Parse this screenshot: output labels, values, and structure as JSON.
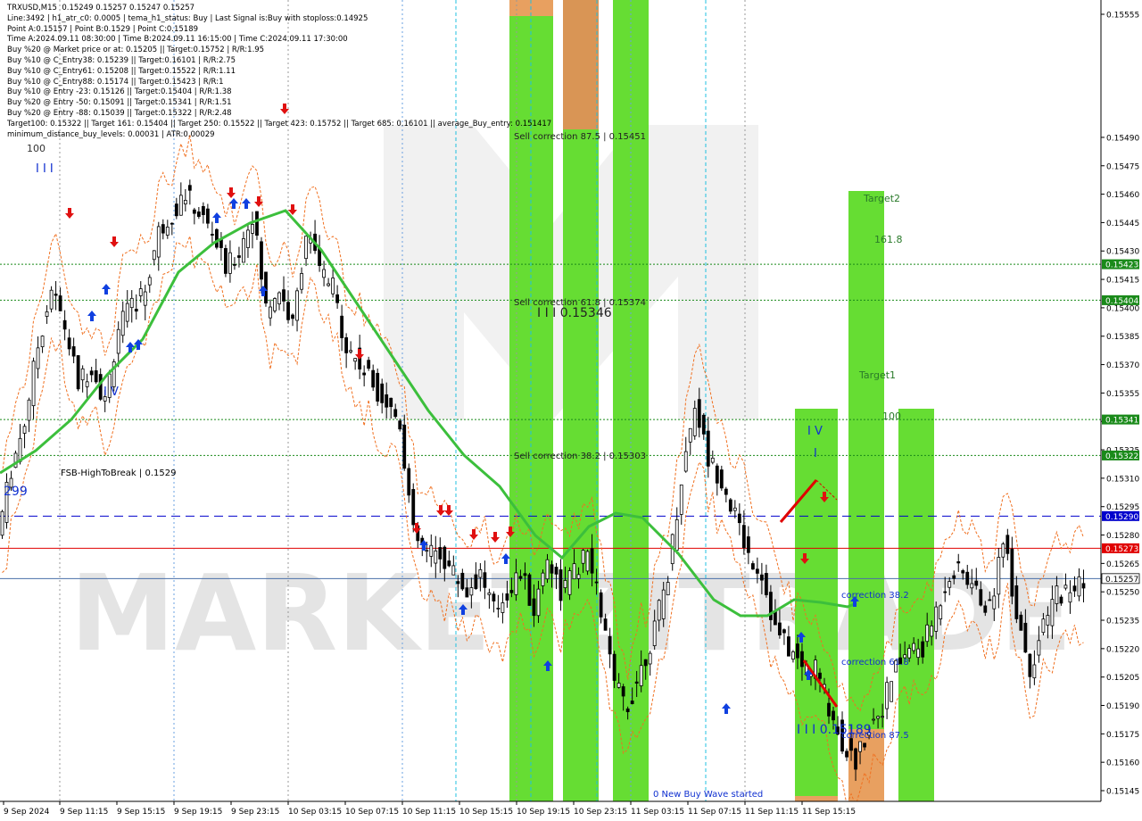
{
  "header": {
    "lines": [
      "TRXUSD,M15  0.15249 0.15257 0.15247 0.15257",
      "Line:3492 | h1_atr_c0: 0.0005 | tema_h1_status: Buy | Last Signal is:Buy with stoploss:0.14925",
      "Point A:0.15157 | Point B:0.1529 | Point C:0.15189",
      "Time A:2024.09.11 08:30:00 | Time B:2024.09.11 16:15:00 | Time C:2024.09.11 17:30:00",
      "Buy %20 @ Market price or at: 0.15205 || Target:0.15752 | R/R:1.95",
      "Buy %10 @ C_Entry38: 0.15239 || Target:0.16101 | R/R:2.75",
      "Buy %10 @ C_Entry61: 0.15208 || Target:0.15522 | R/R:1.11",
      "Buy %10 @ C_Entry88: 0.15174 || Target:0.15423 | R/R:1",
      "Buy %10 @ Entry -23: 0.15126 || Target:0.15404 | R/R:1.38",
      "Buy %20 @ Entry -50: 0.15091 || Target:0.15341 | R/R:1.51",
      "Buy %20 @ Entry -88: 0.15039 || Target:0.15322 | R/R:2.48",
      "Target100: 0.15322 || Target 161: 0.15404 || Target 250: 0.15522 || Target 423: 0.15752 || Target 685: 0.16101 || average_Buy_entry: 0.151417",
      "minimum_distance_buy_levels: 0.00031 | ATR:0.00029"
    ]
  },
  "watermark": "MARKETZITRADE",
  "chart_data": {
    "type": "line",
    "symbol": "TRXUSD",
    "timeframe": "M15",
    "ylim": [
      0.15139,
      0.15559
    ],
    "x_ticks": [
      "9 Sep 2024",
      "9 Sep 11:15",
      "9 Sep 15:15",
      "9 Sep 19:15",
      "9 Sep 23:15",
      "10 Sep 03:15",
      "10 Sep 07:15",
      "10 Sep 11:15",
      "10 Sep 15:15",
      "10 Sep 19:15",
      "10 Sep 23:15",
      "11 Sep 03:15",
      "11 Sep 07:15",
      "11 Sep 11:15",
      "11 Sep 15:15"
    ],
    "y_ticks": [
      "0.15555",
      "0.15490",
      "0.15475",
      "0.15460",
      "0.15445",
      "0.15430",
      "0.15415",
      "0.15400",
      "0.15385",
      "0.15370",
      "0.15355",
      "0.15340",
      "0.15325",
      "0.15310",
      "0.15295",
      "0.15280",
      "0.15265",
      "0.15250",
      "0.15235",
      "0.15220",
      "0.15205",
      "0.15190",
      "0.15175",
      "0.15160",
      "0.15145"
    ],
    "levels": [
      {
        "value": 0.15423,
        "label": "0.15423",
        "color": "#1a8a1a",
        "style": "dotted"
      },
      {
        "value": 0.15404,
        "label": "0.15404",
        "color": "#1a8a1a",
        "style": "dotted"
      },
      {
        "value": 0.15341,
        "label": "0.15341",
        "color": "#1a8a1a",
        "style": "dotted"
      },
      {
        "value": 0.15322,
        "label": "0.15322",
        "color": "#1a8a1a",
        "style": "dotted"
      },
      {
        "value": 0.1529,
        "label": "0.15290",
        "color": "#0000cc",
        "style": "dashed"
      },
      {
        "value": 0.15273,
        "label": "0.15273",
        "color": "#e00000",
        "style": "solid"
      },
      {
        "value": 0.15257,
        "label": "0.15257",
        "color": "#4a6fa8",
        "style": "solid"
      }
    ],
    "labels": {
      "fsb": "FSB-HighToBreak | 0.1529",
      "fsb_left": "299",
      "wave_iii_top": "I I I",
      "wave_100_top": "100",
      "wave_iv_left": "I V",
      "sell_875": "Sell correction 87.5 | 0.15451",
      "sell_618": "Sell correction 61.8 | 0.15374",
      "sell_mid": "I I I 0.15346",
      "sell_382": "Sell correction 38.2 | 0.15303",
      "target2": "Target2",
      "t1618": "161.8",
      "target1": "Target1",
      "t100": "100",
      "wave_iv_right": "I V",
      "wave_i_right": "I",
      "corr_382": "correction 38.2",
      "corr_618": "correction 61.8",
      "corr_875": "correction 87.5",
      "wave_iii_bottom": "I I I 0.15189",
      "new_wave": "0 New Buy Wave started"
    },
    "close_series": [
      0.1528,
      0.15315,
      0.1534,
      0.1538,
      0.1541,
      0.1539,
      0.1536,
      0.1537,
      0.1535,
      0.1539,
      0.154,
      0.1541,
      0.1544,
      0.1545,
      0.1546,
      0.1545,
      0.1544,
      0.1542,
      0.1543,
      0.1545,
      0.154,
      0.1541,
      0.1539,
      0.1544,
      0.1542,
      0.1541,
      0.1538,
      0.1537,
      0.1536,
      0.1535,
      0.1534,
      0.1528,
      0.1527,
      0.1527,
      0.1526,
      0.1525,
      0.1526,
      0.1524,
      0.1525,
      0.1526,
      0.1524,
      0.1527,
      0.1525,
      0.1526,
      0.1527,
      0.1524,
      0.152,
      0.1519,
      0.1521,
      0.1523,
      0.1526,
      0.1531,
      0.1535,
      0.1532,
      0.1531,
      0.1529,
      0.1527,
      0.1526,
      0.1523,
      0.1522,
      0.1521,
      0.1521,
      0.1519,
      0.1517,
      0.1516,
      0.1518,
      0.1519,
      0.1521,
      0.1522,
      0.1522,
      0.1524,
      0.1526,
      0.1526,
      0.1525,
      0.1524,
      0.1528,
      0.1524,
      0.1521,
      0.1523,
      0.1525,
      0.1525,
      0.15257
    ]
  }
}
